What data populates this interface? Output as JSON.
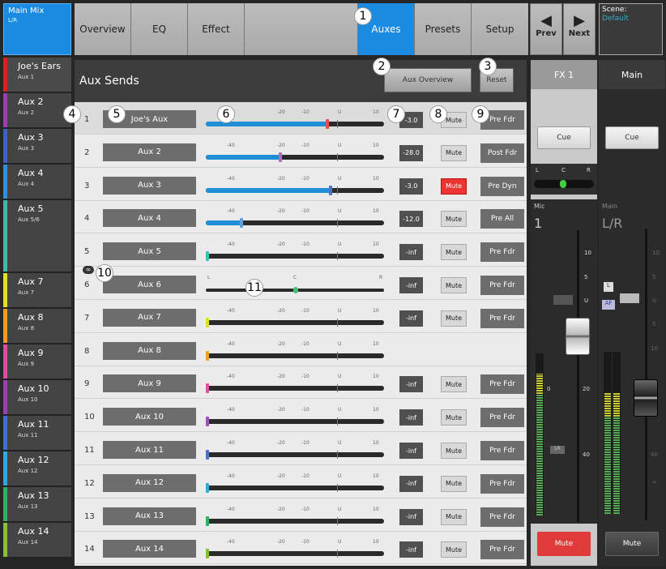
{
  "main_mix": {
    "title": "Main Mix",
    "subtitle": "L/R"
  },
  "tabs": [
    "Overview",
    "EQ",
    "Effect",
    "",
    "Auxes",
    "Presets",
    "Setup"
  ],
  "nav": {
    "prev": "Prev",
    "next": "Next",
    "prev_glyph": "◀",
    "next_glyph": "▶"
  },
  "scene": {
    "label": "Scene:",
    "value": "Default"
  },
  "channels": [
    {
      "name": "Joe's Ears",
      "sub": "Aux 1",
      "color": "#e02020"
    },
    {
      "name": "Aux 2",
      "sub": "Aux 2",
      "color": "#9b3fb0"
    },
    {
      "name": "Aux 3",
      "sub": "Aux 3",
      "color": "#3f5fc8"
    },
    {
      "name": "Aux 4",
      "sub": "Aux 4",
      "color": "#2f8fd8"
    },
    {
      "name": "Aux 5",
      "sub": "Aux 5/6",
      "color": "#3fb8a8"
    },
    {
      "name": "Aux 7",
      "sub": "Aux 7",
      "color": "#e0e020"
    },
    {
      "name": "Aux 8",
      "sub": "Aux 8",
      "color": "#f09a20"
    },
    {
      "name": "Aux 9",
      "sub": "Aux 9",
      "color": "#e04aa0"
    },
    {
      "name": "Aux 10",
      "sub": "Aux 10",
      "color": "#9b3fb0"
    },
    {
      "name": "Aux 11",
      "sub": "Aux 11",
      "color": "#3f6fd0"
    },
    {
      "name": "Aux 12",
      "sub": "Aux 12",
      "color": "#2fa8e0"
    },
    {
      "name": "Aux 13",
      "sub": "Aux 13",
      "color": "#30b060"
    },
    {
      "name": "Aux 14",
      "sub": "Aux 14",
      "color": "#8ac030"
    }
  ],
  "aux_sends": {
    "title": "Aux Sends",
    "overview_button": "Aux Overview",
    "reset_button": "Reset",
    "ticks": [
      "-40",
      "-20",
      "-10",
      "U",
      "10"
    ],
    "pan_ticks": [
      "L",
      "C",
      "R"
    ],
    "mute_label": "Mute",
    "rows": [
      {
        "num": "1",
        "name": "Joe's Aux",
        "level": 0.68,
        "value": "-3.0",
        "muted": false,
        "tap": "Pre Fdr",
        "knob": "#e05050",
        "highlight": true
      },
      {
        "num": "2",
        "name": "Aux 2",
        "level": 0.42,
        "value": "-28.0",
        "muted": false,
        "tap": "Post Fdr",
        "knob": "#b070c0"
      },
      {
        "num": "3",
        "name": "Aux 3",
        "level": 0.7,
        "value": "-3.0",
        "muted": true,
        "tap": "Pre Dyn",
        "knob": "#5070d0"
      },
      {
        "num": "4",
        "name": "Aux 4",
        "level": 0.2,
        "value": "-12.0",
        "muted": false,
        "tap": "Pre All",
        "knob": "#60a0e0"
      },
      {
        "num": "5",
        "name": "Aux 5",
        "level": 0.0,
        "value": "-inf",
        "muted": false,
        "tap": "Pre Fdr",
        "knob": "#40c0b0"
      },
      {
        "num": "6",
        "name": "Aux 6",
        "pan": true,
        "value": "-inf",
        "muted": false,
        "tap": "Pre Fdr",
        "knob": "#40c070"
      },
      {
        "num": "7",
        "name": "Aux 7",
        "level": 0.0,
        "value": "-inf",
        "muted": false,
        "tap": "Pre Fdr",
        "knob": "#e0e020"
      },
      {
        "num": "8",
        "name": "Aux 8",
        "level": 0.0,
        "value": "",
        "muted": false,
        "tap": "",
        "knob": "#f0a020",
        "no_controls": true
      },
      {
        "num": "9",
        "name": "Aux 9",
        "level": 0.0,
        "value": "-inf",
        "muted": false,
        "tap": "Pre Fdr",
        "knob": "#e050a0"
      },
      {
        "num": "10",
        "name": "Aux 10",
        "level": 0.0,
        "value": "-inf",
        "muted": false,
        "tap": "Pre Fdr",
        "knob": "#a050c0"
      },
      {
        "num": "11",
        "name": "Aux 11",
        "level": 0.0,
        "value": "-inf",
        "muted": false,
        "tap": "Pre Fdr",
        "knob": "#5070d0"
      },
      {
        "num": "12",
        "name": "Aux 12",
        "level": 0.0,
        "value": "-inf",
        "muted": false,
        "tap": "Pre Fdr",
        "knob": "#30a8e0"
      },
      {
        "num": "13",
        "name": "Aux 13",
        "level": 0.0,
        "value": "-inf",
        "muted": false,
        "tap": "Pre Fdr",
        "knob": "#30b060"
      },
      {
        "num": "14",
        "name": "Aux 14",
        "level": 0.0,
        "value": "-inf",
        "muted": false,
        "tap": "Pre Fdr",
        "knob": "#80c030"
      }
    ]
  },
  "fx_strip": {
    "title": "FX 1",
    "cue": "Cue",
    "pan_labels": [
      "L",
      "C",
      "R"
    ],
    "input_label": "Mic",
    "input_num": "1",
    "scale": [
      "10",
      "5",
      "U",
      "0",
      "20",
      "40"
    ],
    "lr_badge": "LR",
    "mute": "Mute"
  },
  "main_strip": {
    "title": "Main",
    "cue": "Cue",
    "label": "Main",
    "sublabel": "L/R",
    "badges": [
      "L",
      "AF"
    ],
    "scale": [
      "10",
      "5",
      "U",
      "5",
      "10",
      "20",
      "40",
      "∞"
    ],
    "mute": "Mute"
  },
  "callouts": [
    "1",
    "2",
    "3",
    "4",
    "5",
    "6",
    "7",
    "8",
    "9",
    "10",
    "11"
  ]
}
